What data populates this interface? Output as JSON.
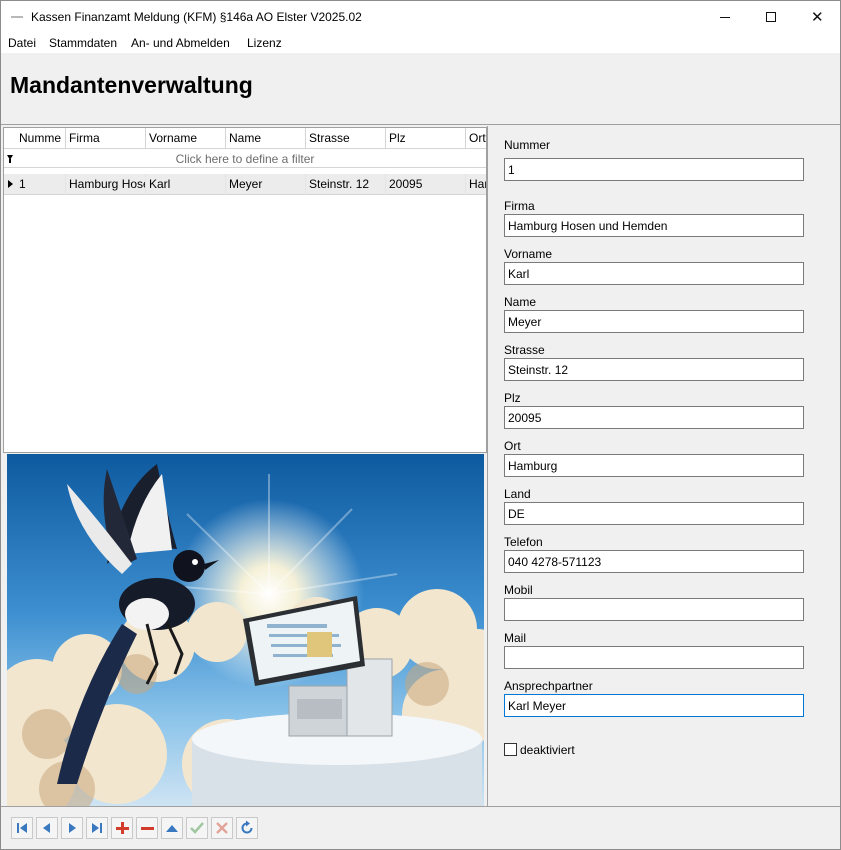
{
  "window": {
    "title": "Kassen Finanzamt Meldung (KFM) §146a AO Elster V2025.02",
    "controls": {
      "minimize": "minimize-icon",
      "maximize": "maximize-icon",
      "close": "✕"
    }
  },
  "menu": {
    "items": [
      "Datei",
      "Stammdaten",
      "An- und Abmelden",
      "Lizenz"
    ]
  },
  "page": {
    "title": "Mandantenverwaltung"
  },
  "grid": {
    "columns": [
      "Numme",
      "Firma",
      "Vorname",
      "Name",
      "Strasse",
      "Plz",
      "Ort"
    ],
    "filter_text": "Click here to define a filter",
    "rows": [
      [
        "1",
        "Hamburg Hosen und Hemden",
        "Karl",
        "Meyer",
        "Steinstr. 12",
        "20095",
        "Hamburg"
      ]
    ]
  },
  "picture": {
    "description": "",
    "icon": "magpie-and-pos-terminal-illustration"
  },
  "form": {
    "fields": [
      {
        "label": "Nummer",
        "value": "1"
      },
      {
        "label": "Firma",
        "value": "Hamburg Hosen und Hemden"
      },
      {
        "label": "Vorname",
        "value": "Karl"
      },
      {
        "label": "Name",
        "value": "Meyer"
      },
      {
        "label": "Strasse",
        "value": "Steinstr. 12"
      },
      {
        "label": "Plz",
        "value": "20095"
      },
      {
        "label": "Ort",
        "value": "Hamburg"
      },
      {
        "label": "Land",
        "value": "DE"
      },
      {
        "label": "Telefon",
        "value": "040 4278-571123"
      },
      {
        "label": "Mobil",
        "value": ""
      },
      {
        "label": "Mail",
        "value": ""
      },
      {
        "label": "Ansprechpartner",
        "value": "Karl Meyer"
      }
    ],
    "deaktiviert": {
      "label": "deaktiviert",
      "checked": false
    }
  },
  "navigator": {
    "buttons": [
      "first-icon",
      "prev-icon",
      "next-icon",
      "last-icon",
      "add-icon",
      "delete-icon",
      "edit-icon",
      "save-icon",
      "cancel-icon",
      "refresh-icon"
    ]
  },
  "colors": {
    "accent": "#0078d7",
    "nav_blue": "#3a78c0",
    "nav_red": "#d23c2a",
    "sky": "#3d8fd0"
  }
}
